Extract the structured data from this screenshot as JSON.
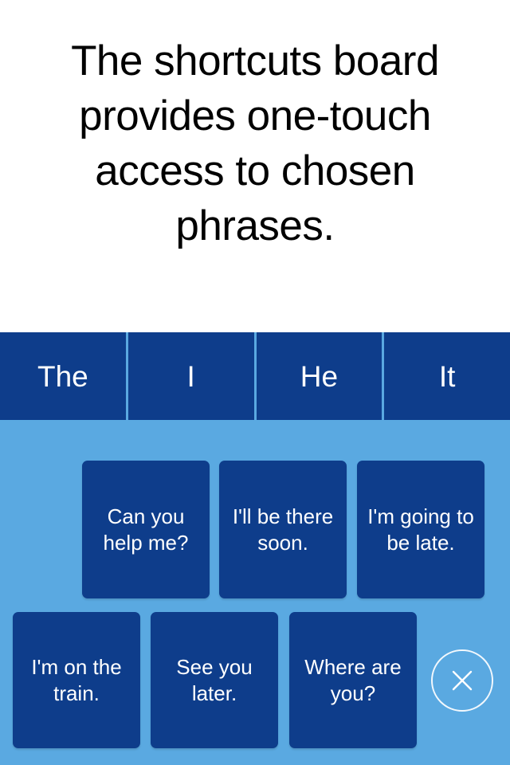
{
  "intro": {
    "text": "The shortcuts board provides one-touch access to chosen phrases."
  },
  "tabs": [
    {
      "label": "The"
    },
    {
      "label": "I"
    },
    {
      "label": "He"
    },
    {
      "label": "It"
    }
  ],
  "board": {
    "rows": [
      {
        "tiles": [
          {
            "label": "Can you help me?"
          },
          {
            "label": "I'll be there soon."
          },
          {
            "label": "I'm going to be late."
          }
        ]
      },
      {
        "tiles": [
          {
            "label": "I'm on the train."
          },
          {
            "label": "See you later."
          },
          {
            "label": "Where are you?"
          }
        ]
      }
    ],
    "close_button": {
      "icon": "close-x-icon"
    }
  },
  "colors": {
    "tile_blue": "#0e3d8b",
    "board_blue": "#5aa9e1",
    "text_white": "#ffffff",
    "page_background": "#ffffff",
    "heading_text": "#000000"
  }
}
